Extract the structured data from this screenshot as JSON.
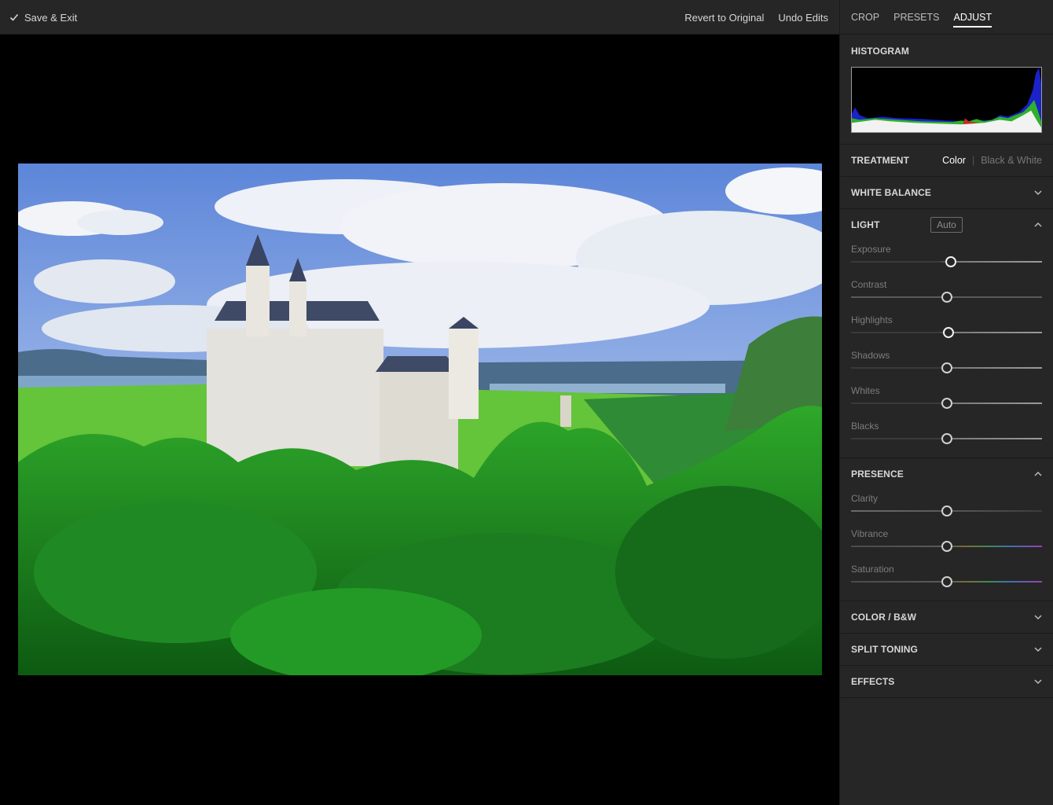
{
  "topbar": {
    "save_exit": "Save & Exit",
    "revert": "Revert to Original",
    "undo": "Undo Edits"
  },
  "panel": {
    "tabs": [
      {
        "label": "CROP",
        "active": false
      },
      {
        "label": "PRESETS",
        "active": false
      },
      {
        "label": "ADJUST",
        "active": true
      }
    ],
    "histogram": {
      "title": "HISTOGRAM"
    },
    "treatment": {
      "title": "TREATMENT",
      "options": [
        "Color",
        "Black & White"
      ],
      "selected": "Color"
    },
    "white_balance": {
      "title": "WHITE BALANCE",
      "expanded": false
    },
    "light": {
      "title": "LIGHT",
      "auto_label": "Auto",
      "expanded": true,
      "sliders": [
        {
          "label": "Exposure",
          "value": 0.52
        },
        {
          "label": "Contrast",
          "value": 0.5
        },
        {
          "label": "Highlights",
          "value": 0.51
        },
        {
          "label": "Shadows",
          "value": 0.5
        },
        {
          "label": "Whites",
          "value": 0.5
        },
        {
          "label": "Blacks",
          "value": 0.5
        }
      ]
    },
    "presence": {
      "title": "PRESENCE",
      "expanded": true,
      "sliders": [
        {
          "label": "Clarity",
          "value": 0.5
        },
        {
          "label": "Vibrance",
          "value": 0.5
        },
        {
          "label": "Saturation",
          "value": 0.5
        }
      ]
    },
    "collapsed_sections": [
      {
        "title": "COLOR / B&W"
      },
      {
        "title": "SPLIT TONING"
      },
      {
        "title": "EFFECTS"
      }
    ]
  },
  "icons": {
    "save": "checkmark-icon",
    "expand": "chevron-down-icon",
    "collapse": "chevron-up-icon"
  },
  "colors": {
    "panel_bg": "#262626",
    "canvas_bg": "#000000",
    "active_tab": "#ffffff",
    "label_dim": "#7d7d7d"
  }
}
